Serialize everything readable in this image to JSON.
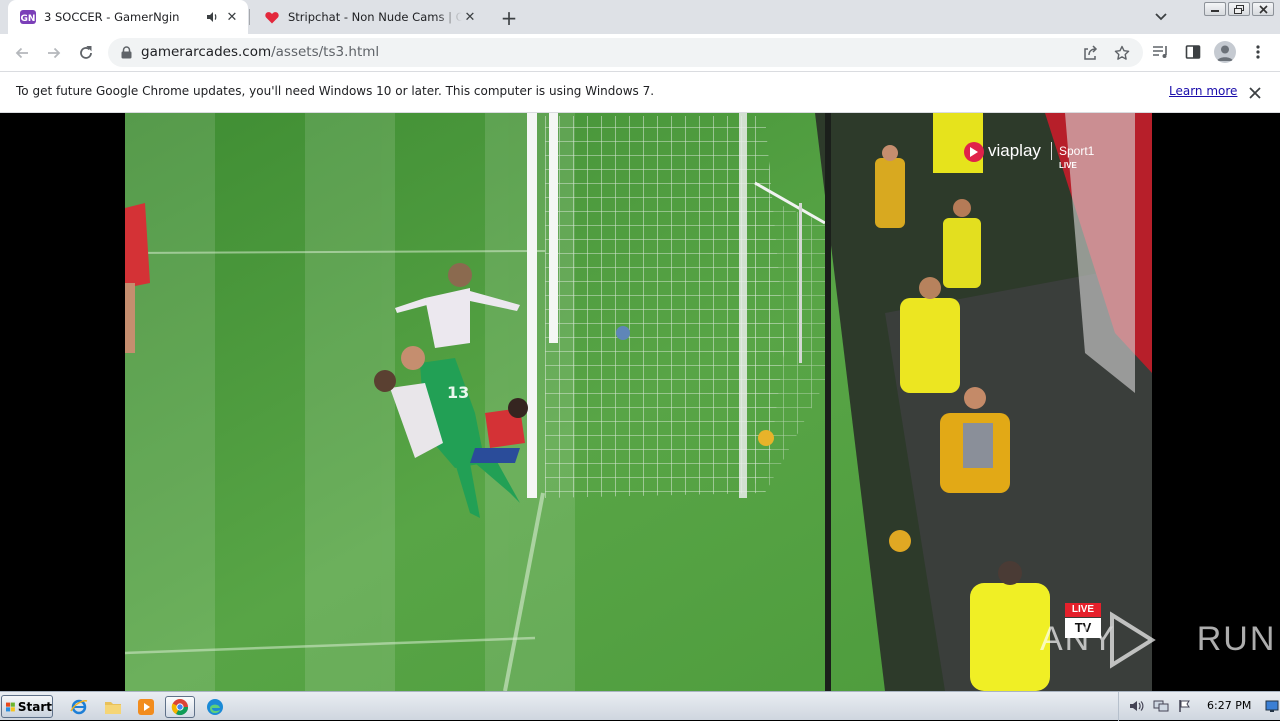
{
  "tabs": [
    {
      "title": "3 SOCCER - GamerNgin",
      "favicon": "gamerngin-icon",
      "audio": "speaker-icon",
      "active": true
    },
    {
      "title": "Stripchat - Non Nude Cams | Chat wi",
      "favicon": "heart-icon",
      "active": false
    }
  ],
  "toolbar": {
    "url_host": "gamerarcades.com",
    "url_path": "/assets/ts3.html"
  },
  "infobar": {
    "message": "To get future Google Chrome updates, you'll need Windows 10 or later. This computer is using Windows 7.",
    "link": "Learn more"
  },
  "video": {
    "broadcaster": "viaplay",
    "channel": "Sport1",
    "live_tag": "LIVE",
    "corner_badge_top": "LIVE",
    "corner_badge_bottom": "TV",
    "watermark": "ANY RUN",
    "shirt_number": "13"
  },
  "taskbar": {
    "start_label": "Start",
    "clock": "6:27 PM"
  },
  "colors": {
    "pitch": "#4e9a3d",
    "gamerngin_purple": "#7b3fb8",
    "heart_red": "#e3283c",
    "link_blue": "#1a0dab"
  }
}
